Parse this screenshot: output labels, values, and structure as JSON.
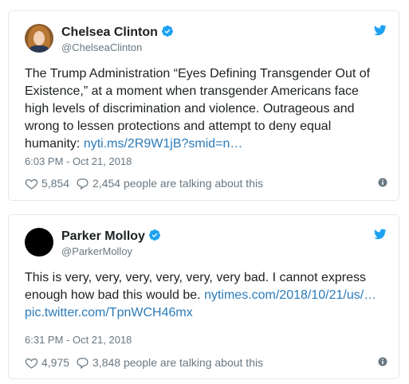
{
  "tweets": [
    {
      "author": {
        "name": "Chelsea Clinton",
        "handle": "@ChelseaClinton"
      },
      "text": "The Trump Administration “Eyes Defining Transgender Out of Existence,” at a moment when transgender Americans face high levels of discrimination and violence. Outrageous and wrong to lessen protections and attempt to deny equal humanity: ",
      "links": [
        "nyti.ms/2R9W1jB?smid=n…"
      ],
      "timestamp": "6:03 PM - Oct 21, 2018",
      "likes": "5,854",
      "talking": "2,454 people are talking about this"
    },
    {
      "author": {
        "name": "Parker Molloy",
        "handle": "@ParkerMolloy"
      },
      "text": "This is very, very, very, very, very, very bad. I cannot express enough how bad this would be. ",
      "links": [
        "nytimes.com/2018/10/21/us/…",
        "pic.twitter.com/TpnWCH46mx"
      ],
      "timestamp": "6:31 PM - Oct 21, 2018",
      "likes": "4,975",
      "talking": "3,848 people are talking about this"
    }
  ],
  "colors": {
    "link": "#2b7bb9",
    "verified": "#1da1f2",
    "twitter_bird": "#1da1f2",
    "meta_text": "#697882",
    "border": "#e1e8ed"
  },
  "icons": [
    "verified-badge-icon",
    "twitter-bird-icon",
    "heart-icon",
    "reply-bubble-icon",
    "info-icon"
  ]
}
